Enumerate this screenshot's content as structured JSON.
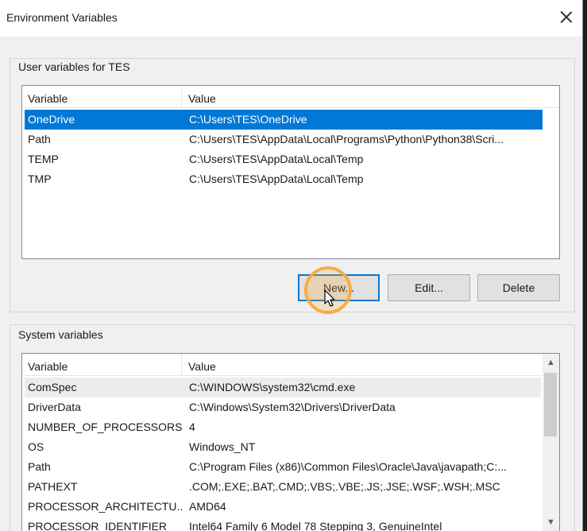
{
  "window": {
    "title": "Environment Variables"
  },
  "user_vars": {
    "label": "User variables for TES",
    "columns": [
      "Variable",
      "Value"
    ],
    "rows": [
      {
        "variable": "OneDrive",
        "value": "C:\\Users\\TES\\OneDrive",
        "selected": true
      },
      {
        "variable": "Path",
        "value": "C:\\Users\\TES\\AppData\\Local\\Programs\\Python\\Python38\\Scri..."
      },
      {
        "variable": "TEMP",
        "value": "C:\\Users\\TES\\AppData\\Local\\Temp"
      },
      {
        "variable": "TMP",
        "value": "C:\\Users\\TES\\AppData\\Local\\Temp"
      }
    ]
  },
  "buttons": {
    "new": "New...",
    "edit": "Edit...",
    "delete": "Delete"
  },
  "system_vars": {
    "label": "System variables",
    "columns": [
      "Variable",
      "Value"
    ],
    "rows": [
      {
        "variable": "ComSpec",
        "value": "C:\\WINDOWS\\system32\\cmd.exe"
      },
      {
        "variable": "DriverData",
        "value": "C:\\Windows\\System32\\Drivers\\DriverData"
      },
      {
        "variable": "NUMBER_OF_PROCESSORS",
        "value": "4"
      },
      {
        "variable": "OS",
        "value": "Windows_NT"
      },
      {
        "variable": "Path",
        "value": "C:\\Program Files (x86)\\Common Files\\Oracle\\Java\\javapath;C:..."
      },
      {
        "variable": "PATHEXT",
        "value": ".COM;.EXE;.BAT;.CMD;.VBS;.VBE;.JS;.JSE;.WSF;.WSH;.MSC"
      },
      {
        "variable": "PROCESSOR_ARCHITECTU...",
        "value": "AMD64"
      },
      {
        "variable": "PROCESSOR_IDENTIFIER",
        "value": "Intel64 Family 6 Model 78 Stepping 3, GenuineIntel"
      }
    ]
  },
  "colors": {
    "selection": "#0078d7",
    "click_highlight": "#f7a836"
  },
  "icons": {
    "close": "close-icon",
    "scroll_up": "chevron-up-icon",
    "scroll_down": "chevron-down-icon",
    "cursor": "mouse-pointer-icon"
  }
}
